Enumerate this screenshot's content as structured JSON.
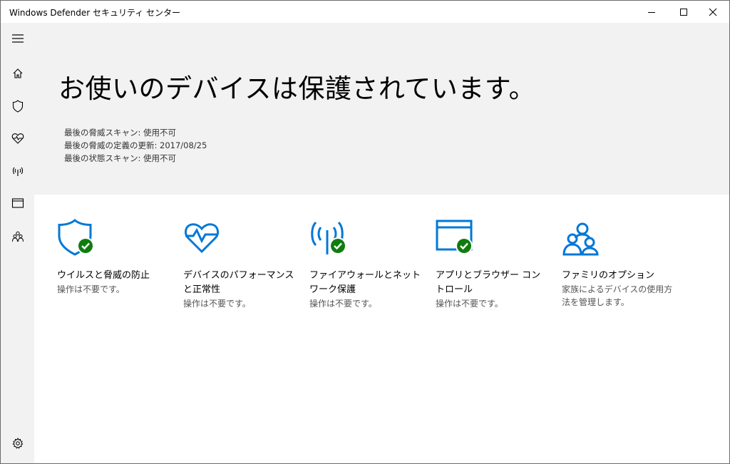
{
  "window": {
    "title": "Windows Defender セキュリティ センター"
  },
  "sidebar": {
    "items": [
      {
        "name": "menu",
        "icon": "hamburger-icon"
      },
      {
        "name": "home",
        "icon": "home-icon"
      },
      {
        "name": "virus-protection",
        "icon": "shield-icon"
      },
      {
        "name": "device-performance",
        "icon": "heart-pulse-icon"
      },
      {
        "name": "firewall",
        "icon": "antenna-icon"
      },
      {
        "name": "app-browser",
        "icon": "browser-window-icon"
      },
      {
        "name": "family",
        "icon": "family-icon"
      },
      {
        "name": "settings",
        "icon": "gear-icon"
      }
    ]
  },
  "hero": {
    "title": "お使いのデバイスは保護されています。",
    "last_threat_scan": "最後の脅威スキャン: 使用不可",
    "last_definition_update": "最後の脅威の定義の更新: 2017/08/25",
    "last_health_scan": "最後の状態スキャン: 使用不可"
  },
  "tiles": [
    {
      "title": "ウイルスと脅威の防止",
      "desc": "操作は不要です。",
      "icon": "shield-check-icon"
    },
    {
      "title": "デバイスのパフォーマンスと正常性",
      "desc": "操作は不要です。",
      "icon": "heart-pulse-check-icon"
    },
    {
      "title": "ファイアウォールとネットワーク保護",
      "desc": "操作は不要です。",
      "icon": "antenna-check-icon"
    },
    {
      "title": "アプリとブラウザー コントロール",
      "desc": "操作は不要です。",
      "icon": "browser-check-icon"
    },
    {
      "title": "ファミリのオプション",
      "desc": "家族によるデバイスの使用方法を管理します。",
      "icon": "family-icon"
    }
  ],
  "colors": {
    "accent": "#0078d7",
    "ok_badge": "#107c10",
    "hero_bg": "#f2f2f2"
  }
}
